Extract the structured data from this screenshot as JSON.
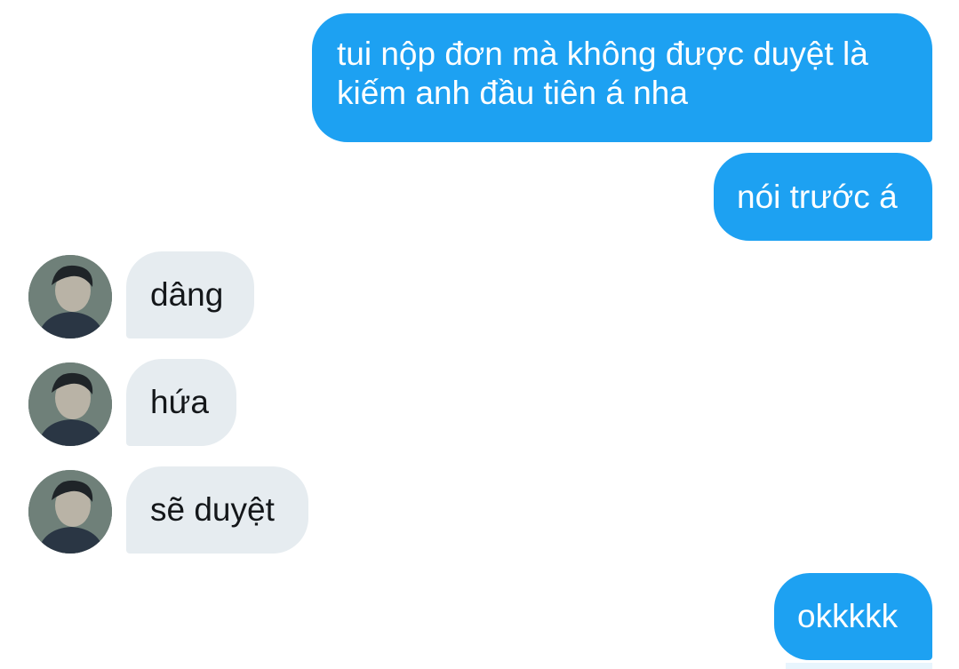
{
  "conversation": {
    "messages": [
      {
        "sender": "me",
        "lines": [
          "tui nộp đơn mà không được duyệt là",
          "kiếm anh đầu tiên á nha"
        ]
      },
      {
        "sender": "me",
        "text": "nói trước á"
      },
      {
        "sender": "other",
        "text": "dâng"
      },
      {
        "sender": "other",
        "text": "hứa"
      },
      {
        "sender": "other",
        "text": "sẽ duyệt"
      },
      {
        "sender": "me",
        "text": "okkkkk"
      }
    ]
  },
  "colors": {
    "sent_bubble": "#1da1f2",
    "received_bubble": "#e6ecf0",
    "sent_text": "#ffffff",
    "received_text": "#14171a",
    "background": "#ffffff"
  },
  "icons": {
    "avatar": "user-avatar-photo"
  }
}
